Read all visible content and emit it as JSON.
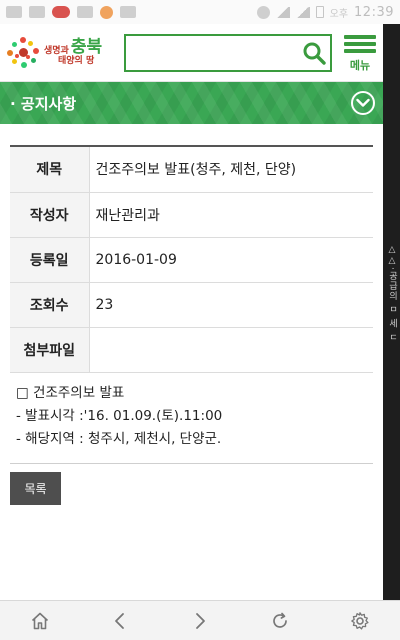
{
  "status_bar": {
    "time": "12:39",
    "carrier": "오후"
  },
  "header": {
    "logo": {
      "line1": "생명과",
      "line2": "충북",
      "line3": "태양의 땅"
    },
    "search": {
      "value": "",
      "placeholder": ""
    },
    "menu_label": "메뉴"
  },
  "section": {
    "title": "· 공지사항"
  },
  "detail": {
    "rows": [
      {
        "label": "제목",
        "value": "건조주의보 발표(청주, 제천, 단양)"
      },
      {
        "label": "작성자",
        "value": "재난관리과"
      },
      {
        "label": "등록일",
        "value": "2016-01-09"
      },
      {
        "label": "조회수",
        "value": "23"
      },
      {
        "label": "첨부파일",
        "value": ""
      }
    ]
  },
  "content": {
    "lines": [
      "□ 건조주의보 발표",
      "- 발표시각 :'16. 01.09.(토).11:00",
      "- 해당지역 : 청주시, 제천시, 단양군."
    ]
  },
  "buttons": {
    "list_label": "목록"
  },
  "side_text": "△△·공급의 ㅁ 세 ㄷ",
  "colors": {
    "brand_green": "#3aa754",
    "header_green": "#3a9b3e",
    "button_dark": "#4e4e4e"
  },
  "bottom_nav": {
    "icons": [
      "home-icon",
      "back-icon",
      "forward-icon",
      "refresh-icon",
      "settings-icon"
    ]
  }
}
